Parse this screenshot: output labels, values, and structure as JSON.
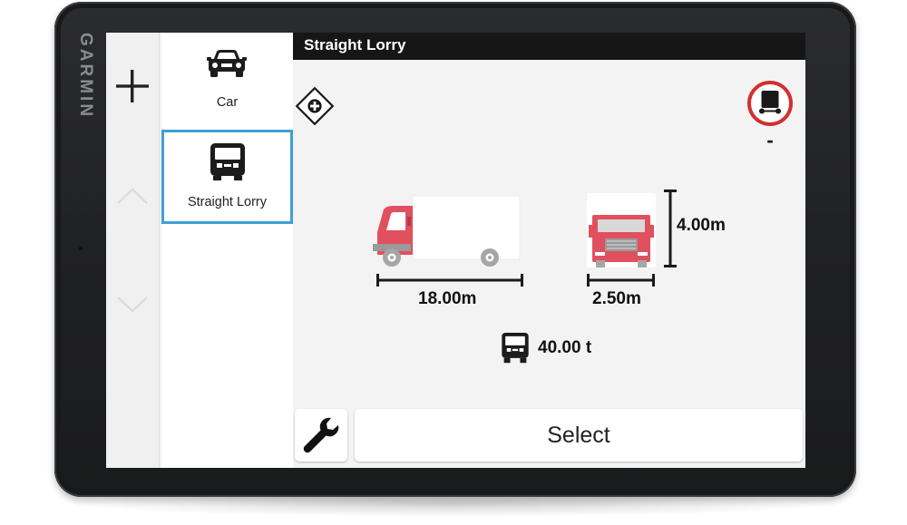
{
  "device": {
    "brand": "GARMIN"
  },
  "nav": {
    "add_label": "+",
    "up": "up",
    "down": "down"
  },
  "vehicles": [
    {
      "label": "Car",
      "icon": "car-icon",
      "selected": false
    },
    {
      "label": "Straight Lorry",
      "icon": "lorry-icon",
      "selected": true
    }
  ],
  "profile": {
    "title": "Straight Lorry",
    "length": "18.00m",
    "width": "2.50m",
    "height": "4.00m",
    "weight": "40.00 t",
    "restriction_value": "-"
  },
  "actions": {
    "select_label": "Select",
    "settings_icon": "wrench-icon"
  },
  "colors": {
    "accent": "#3ea0d6",
    "truck": "#e0505f",
    "sign_red": "#d32f2f"
  }
}
